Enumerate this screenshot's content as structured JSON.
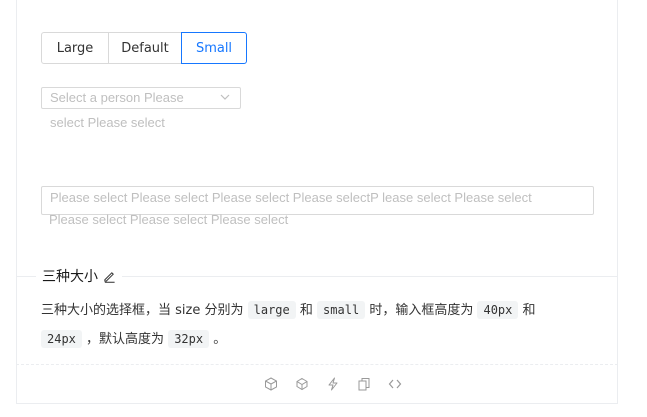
{
  "size_group": {
    "buttons": [
      {
        "label": "Large",
        "active": false
      },
      {
        "label": "Default",
        "active": false
      },
      {
        "label": "Small",
        "active": true
      }
    ]
  },
  "select_small": {
    "placeholder_line1": "Select a person Please",
    "placeholder_line2": "select Please select"
  },
  "select_wide": {
    "placeholder_line1": "Please select Please select Please select Please selectP lease select Please select",
    "placeholder_line2": "Please select Please select Please select"
  },
  "meta": {
    "title": "三种大小"
  },
  "description": {
    "t1": "三种大小的选择框，当 size 分别为",
    "c1": "large",
    "t2": "和",
    "c2": "small",
    "t3": "时，输入框高度为",
    "c3": "40px",
    "t4": "和",
    "c4": "24px",
    "t5": "，默认高度为",
    "c5": "32px",
    "t6": "。"
  },
  "colors": {
    "accent": "#1677ff",
    "border": "#d9d9d9",
    "placeholder": "#bfbfbf"
  },
  "actions": [
    "codesandbox-icon",
    "codepen-icon",
    "stackblitz-icon",
    "copy-icon",
    "code-expand-icon"
  ]
}
